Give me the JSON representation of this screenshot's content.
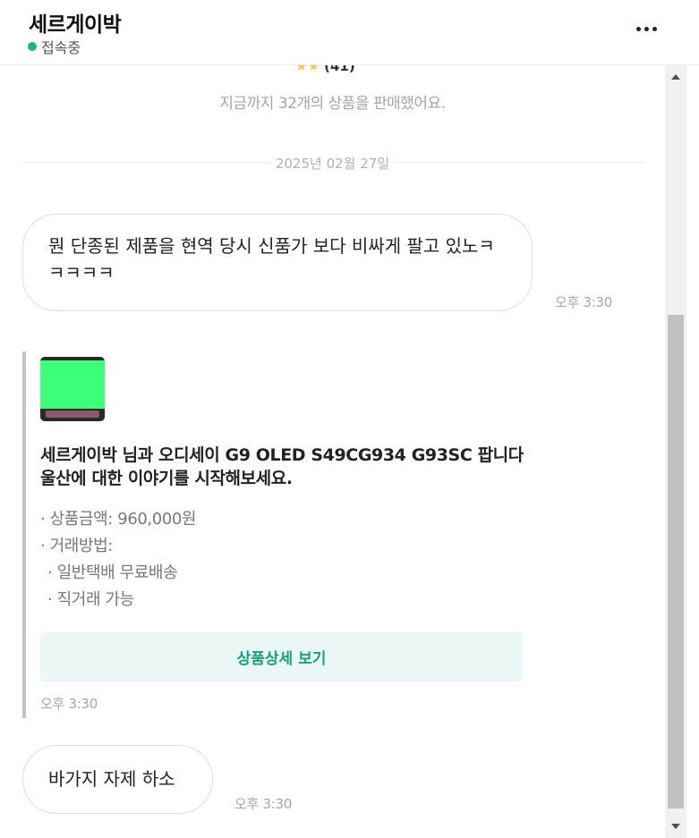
{
  "header": {
    "title": "세르게이박",
    "status": "접속중",
    "status_color": "#12b886",
    "more_icon": "more-horizontal-icon"
  },
  "chat": {
    "clipped_text": "(41)",
    "sold_text": "지금까지 32개의 상품을 판매했어요.",
    "date": "2025년 02월 27일",
    "message1": {
      "text": "뭔 단종된 제품을 현역 당시 신품가 보다 비싸게 팔고 있노ㅋㅋㅋㅋㅋ",
      "time": "오후 3:30"
    },
    "product_card": {
      "title": "세르게이박 님과 오디세이 G9 OLED S49CG934 G93SC 팝니다 울산에 대한 이야기를 시작해보세요.",
      "price_line": "· 상품금액: 960,000원",
      "method_label": "· 거래방법:",
      "method_1": "· 일반택배 무료배송",
      "method_2": "· 직거래 가능",
      "button_label": "상품상세 보기",
      "time": "오후 3:30",
      "accent": "#14a37f"
    },
    "message2": {
      "text": "바가지 자제 하소",
      "time": "오후 3:30"
    }
  }
}
